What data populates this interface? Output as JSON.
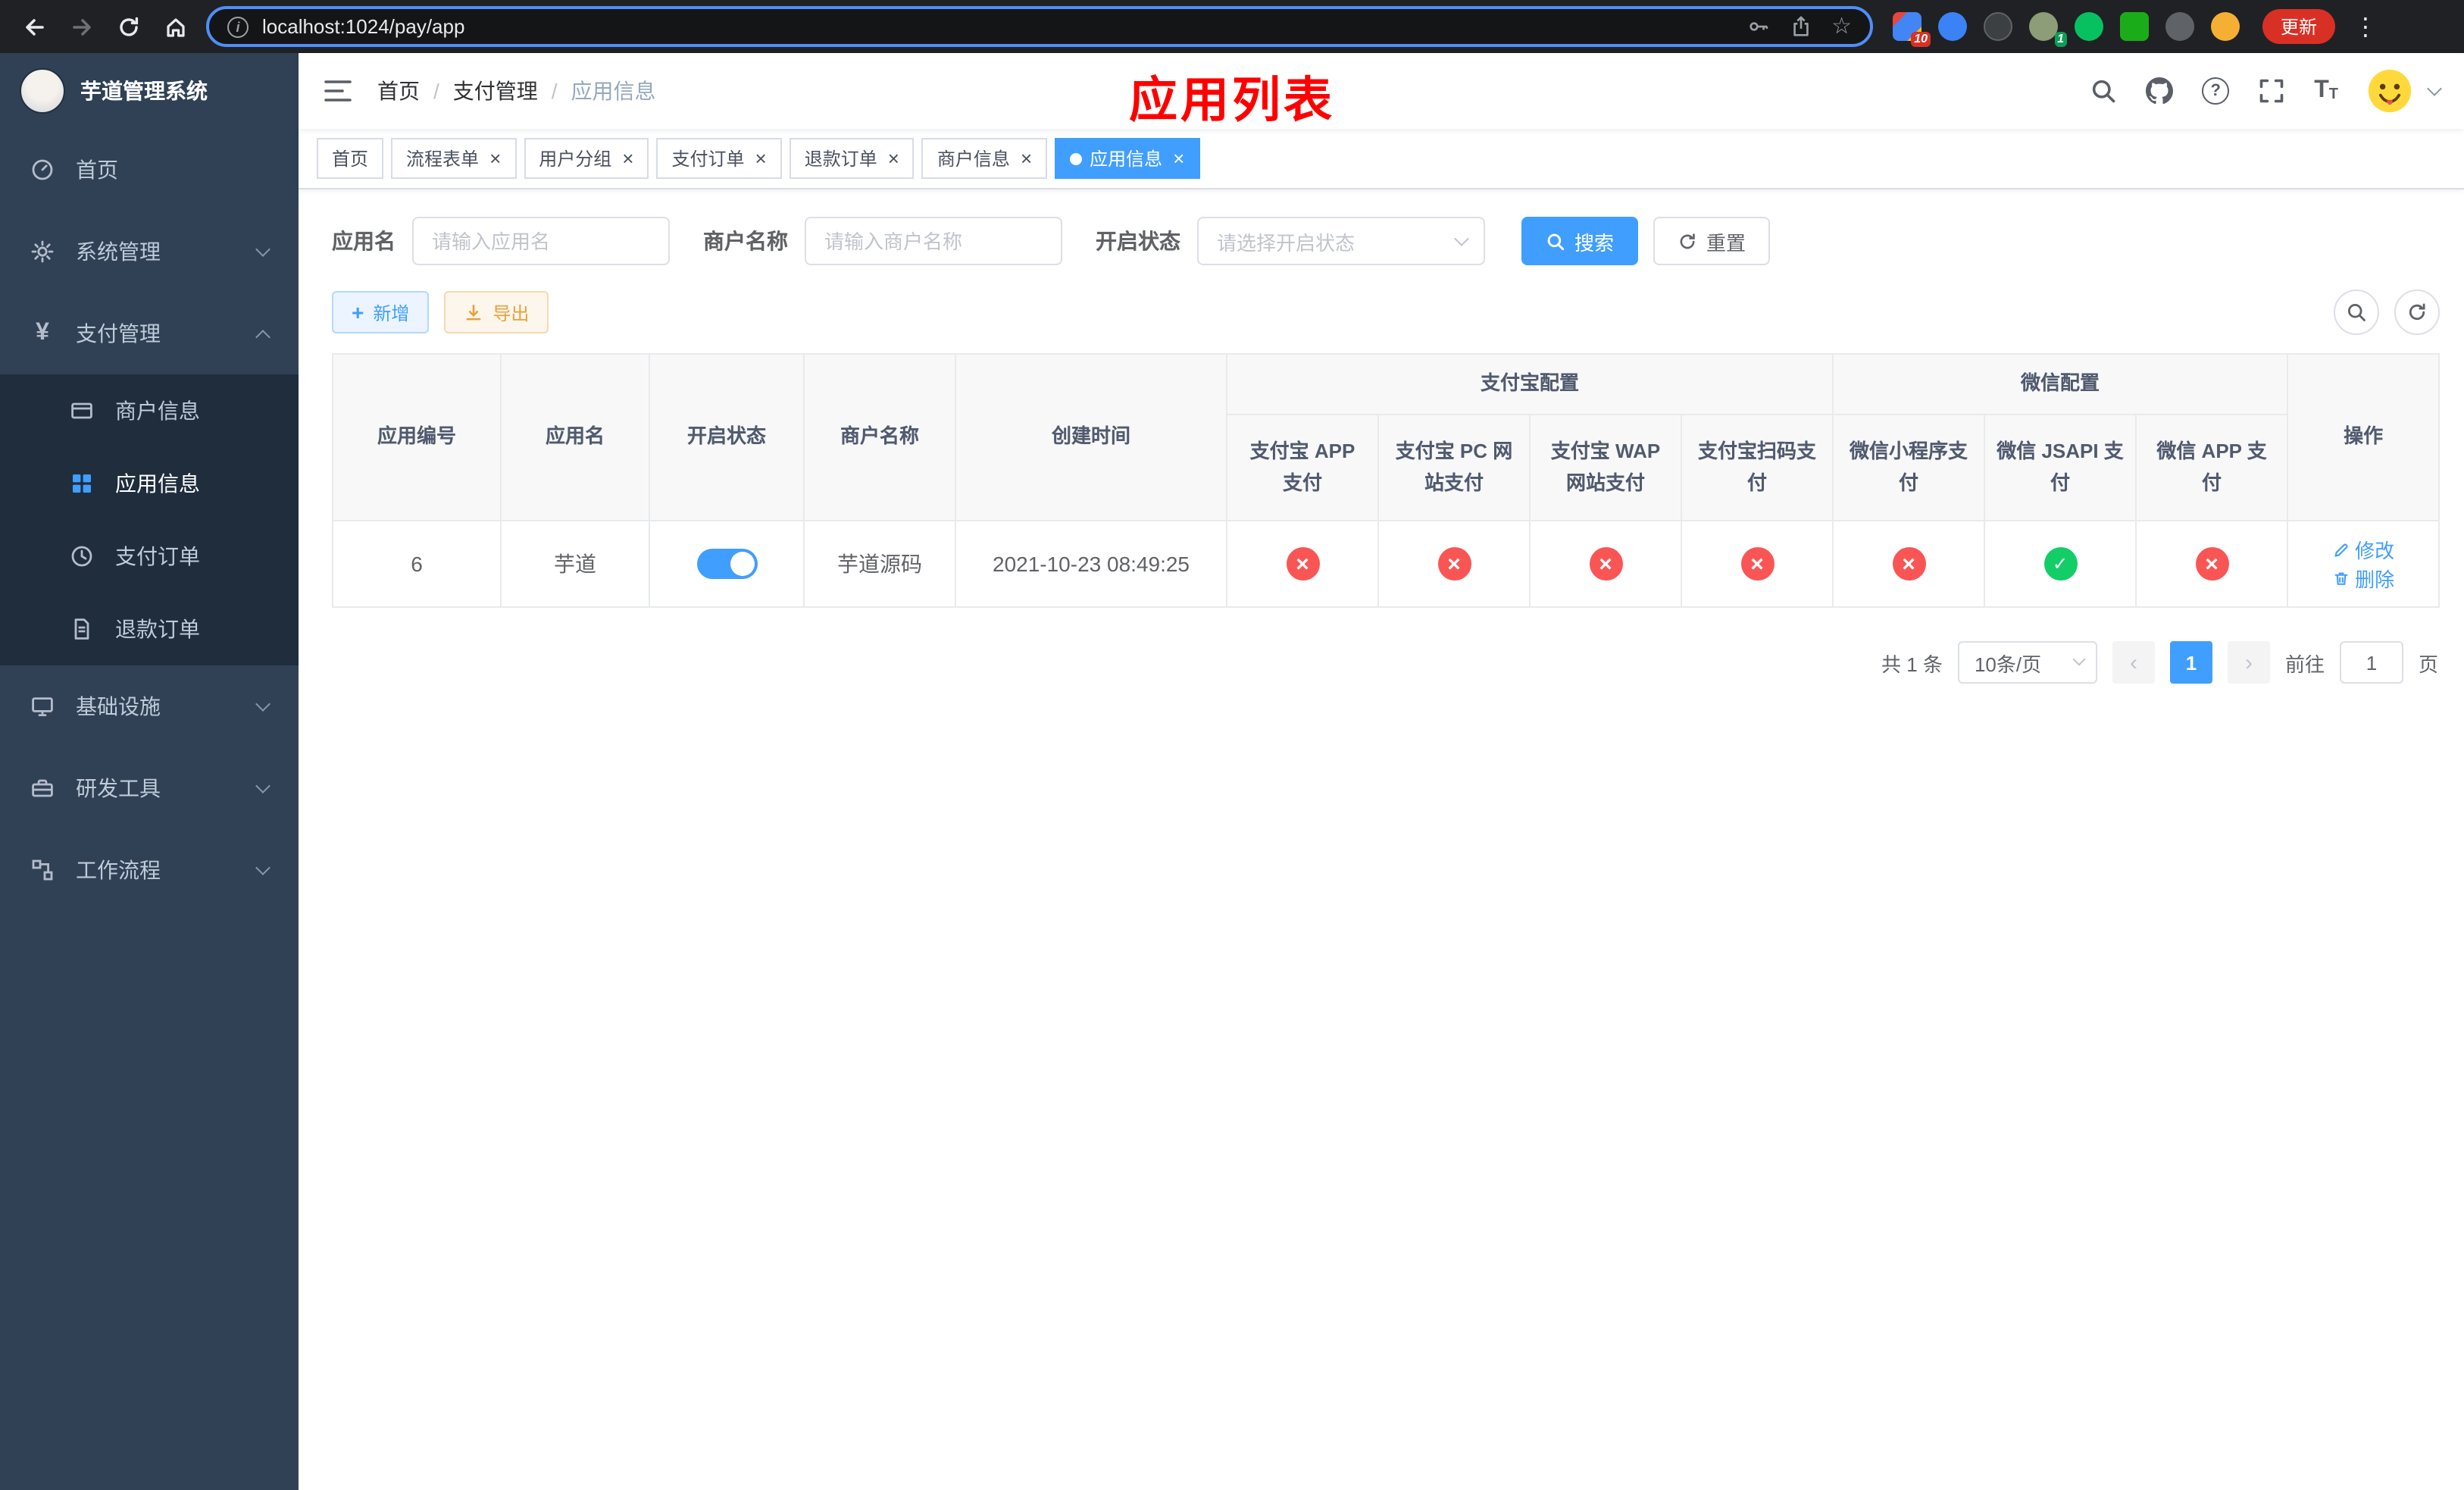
{
  "colors": {
    "accent": "#409eff",
    "success": "#13ce66",
    "danger": "#fa5555",
    "warning": "#e6a23c",
    "banner": "#ff0000",
    "sidebar": "#304156",
    "sidebarSub": "#1f2d3d"
  },
  "browser": {
    "url": "localhost:1024/pay/app",
    "update_button": "更新",
    "extension_badge": "10",
    "profile_badge": "1"
  },
  "sidebar": {
    "title": "芋道管理系统",
    "items": [
      {
        "label": "首页"
      },
      {
        "label": "系统管理"
      },
      {
        "label": "支付管理"
      },
      {
        "label": "基础设施"
      },
      {
        "label": "研发工具"
      },
      {
        "label": "工作流程"
      }
    ],
    "payment_children": [
      {
        "label": "商户信息"
      },
      {
        "label": "应用信息",
        "state": "active"
      },
      {
        "label": "支付订单"
      },
      {
        "label": "退款订单"
      }
    ]
  },
  "header": {
    "breadcrumb": [
      "首页",
      "支付管理",
      "应用信息"
    ],
    "banner": "应用列表"
  },
  "tabs": [
    {
      "label": "首页"
    },
    {
      "label": "流程表单"
    },
    {
      "label": "用户分组"
    },
    {
      "label": "支付订单"
    },
    {
      "label": "退款订单"
    },
    {
      "label": "商户信息"
    },
    {
      "label": "应用信息",
      "state": "active"
    }
  ],
  "filters": {
    "app_name": {
      "label": "应用名",
      "placeholder": "请输入应用名"
    },
    "merchant_name": {
      "label": "商户名称",
      "placeholder": "请输入商户名称"
    },
    "status": {
      "label": "开启状态",
      "placeholder": "请选择开启状态"
    },
    "search_button": "搜索",
    "reset_button": "重置"
  },
  "toolbar": {
    "add_button": "新增",
    "export_button": "导出"
  },
  "table": {
    "columns": {
      "app_id": "应用编号",
      "app_name": "应用名",
      "status": "开启状态",
      "merchant": "商户名称",
      "created": "创建时间",
      "alipay_group": "支付宝配置",
      "wechat_group": "微信配置",
      "alipay_app": "支付宝 APP 支付",
      "alipay_pc": "支付宝 PC 网站支付",
      "alipay_wap": "支付宝 WAP 网站支付",
      "alipay_qr": "支付宝扫码支付",
      "wechat_mini": "微信小程序支付",
      "wechat_jsapi": "微信 JSAPI 支付",
      "wechat_app": "微信 APP 支付",
      "actions": "操作"
    },
    "row": {
      "app_id": "6",
      "app_name": "芋道",
      "status_state": "on",
      "merchant": "芋道源码",
      "created": "2021-10-23 08:49:25",
      "configs": [
        "cross",
        "cross",
        "cross",
        "cross",
        "cross",
        "check",
        "cross"
      ],
      "edit_link": "修改",
      "delete_link": "删除"
    }
  },
  "pagination": {
    "total": "共 1 条",
    "page_size": "10条/页",
    "current_page": "1",
    "goto_label": "前往",
    "goto_value": "1",
    "page_unit": "页"
  }
}
